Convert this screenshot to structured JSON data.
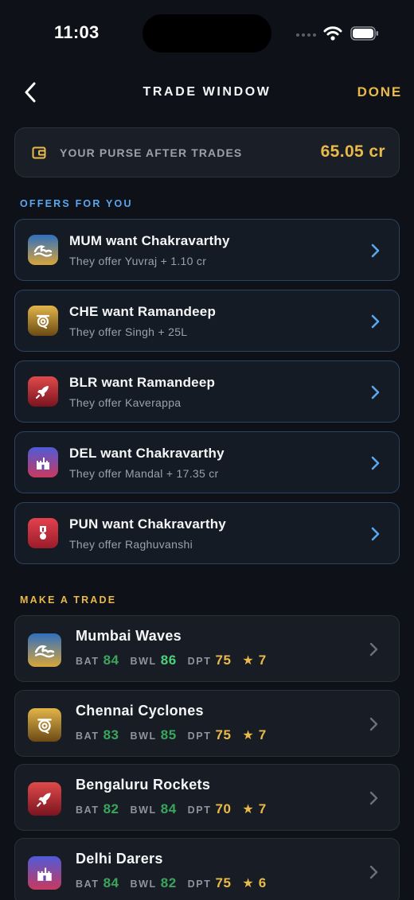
{
  "status": {
    "time": "11:03"
  },
  "nav": {
    "title": "TRADE WINDOW",
    "done_label": "DONE"
  },
  "purse": {
    "label": "YOUR PURSE AFTER TRADES",
    "value": "65.05 cr"
  },
  "offers_section": {
    "label": "OFFERS FOR YOU"
  },
  "offers": [
    {
      "title": "MUM want Chakravarthy",
      "subtitle": "They offer Yuvraj + 1.10 cr",
      "icon": "wave-icon"
    },
    {
      "title": "CHE want Ramandeep",
      "subtitle": "They offer Singh + 25L",
      "icon": "cyclone-icon"
    },
    {
      "title": "BLR want Ramandeep",
      "subtitle": "They offer Kaverappa",
      "icon": "rocket-icon"
    },
    {
      "title": "DEL want Chakravarthy",
      "subtitle": "They offer Mandal + 17.35 cr",
      "icon": "fort-icon"
    },
    {
      "title": "PUN want Chakravarthy",
      "subtitle": "They offer Raghuvanshi",
      "icon": "medal-icon"
    }
  ],
  "trade_section": {
    "label": "MAKE A TRADE"
  },
  "stat_labels": {
    "bat": "BAT",
    "bwl": "BWL",
    "dpt": "DPT"
  },
  "teams": [
    {
      "name": "Mumbai Waves",
      "bat": "84",
      "bwl": "86",
      "dpt": "75",
      "stars": "7",
      "icon": "wave-icon"
    },
    {
      "name": "Chennai Cyclones",
      "bat": "83",
      "bwl": "85",
      "dpt": "75",
      "stars": "7",
      "icon": "cyclone-icon"
    },
    {
      "name": "Bengaluru Rockets",
      "bat": "82",
      "bwl": "84",
      "dpt": "70",
      "stars": "7",
      "icon": "rocket-icon"
    },
    {
      "name": "Delhi Darers",
      "bat": "84",
      "bwl": "82",
      "dpt": "75",
      "stars": "6",
      "icon": "fort-icon"
    }
  ],
  "colors": {
    "accent_gold": "#e9b949",
    "accent_blue": "#5aa7ee",
    "stat_green": "#3aa55d",
    "stat_green_bright": "#4cd17a",
    "background": "#0e1117"
  }
}
